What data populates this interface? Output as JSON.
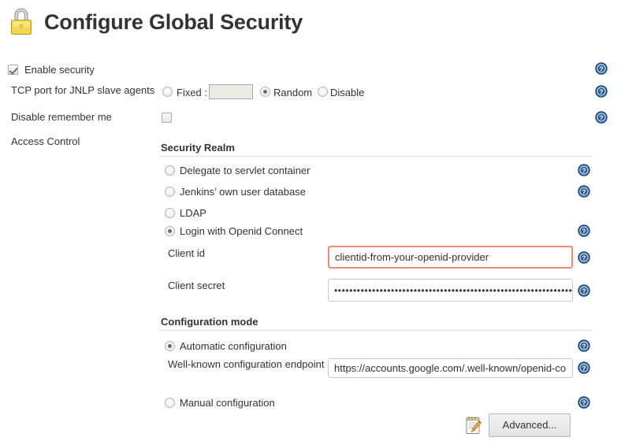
{
  "page": {
    "title": "Configure Global Security",
    "title_icon": "padlock-icon"
  },
  "general": {
    "enable_security": {
      "label": "Enable security",
      "checked": true
    },
    "tcp_port": {
      "label": "TCP port for JNLP slave agents",
      "options": [
        {
          "label": "Fixed :",
          "selected": false
        },
        {
          "label": "Random",
          "selected": true
        },
        {
          "label": "Disable",
          "selected": false
        }
      ],
      "fixed_port_value": ""
    },
    "disable_remember_me": {
      "label": "Disable remember me",
      "checked": false
    },
    "access_control": {
      "label": "Access Control"
    }
  },
  "security_realm": {
    "heading": "Security Realm",
    "options": [
      {
        "label": "Delegate to servlet container",
        "selected": false
      },
      {
        "label": "Jenkins’ own user database",
        "selected": false
      },
      {
        "label": "LDAP",
        "selected": false
      },
      {
        "label": "Login with Openid Connect",
        "selected": true
      }
    ],
    "client_id": {
      "label": "Client id",
      "value": "clientid-from-your-openid-provider"
    },
    "client_secret": {
      "label": "Client secret",
      "value": "••••••••••••••••••••••••••••••••••••••••••••••••••••••••••••••••"
    }
  },
  "configuration_mode": {
    "heading": "Configuration mode",
    "automatic": {
      "label": "Automatic configuration",
      "selected": true
    },
    "well_known_endpoint": {
      "label": "Well-known configuration endpoint",
      "value": "https://accounts.google.com/.well-known/openid-configuration"
    },
    "manual": {
      "label": "Manual configuration",
      "selected": false
    }
  },
  "footer": {
    "advanced_button": "Advanced...",
    "advanced_icon": "notepad-pencil-icon"
  },
  "help": {
    "icon_name": "help-icon",
    "color": "#2b5f9e"
  }
}
